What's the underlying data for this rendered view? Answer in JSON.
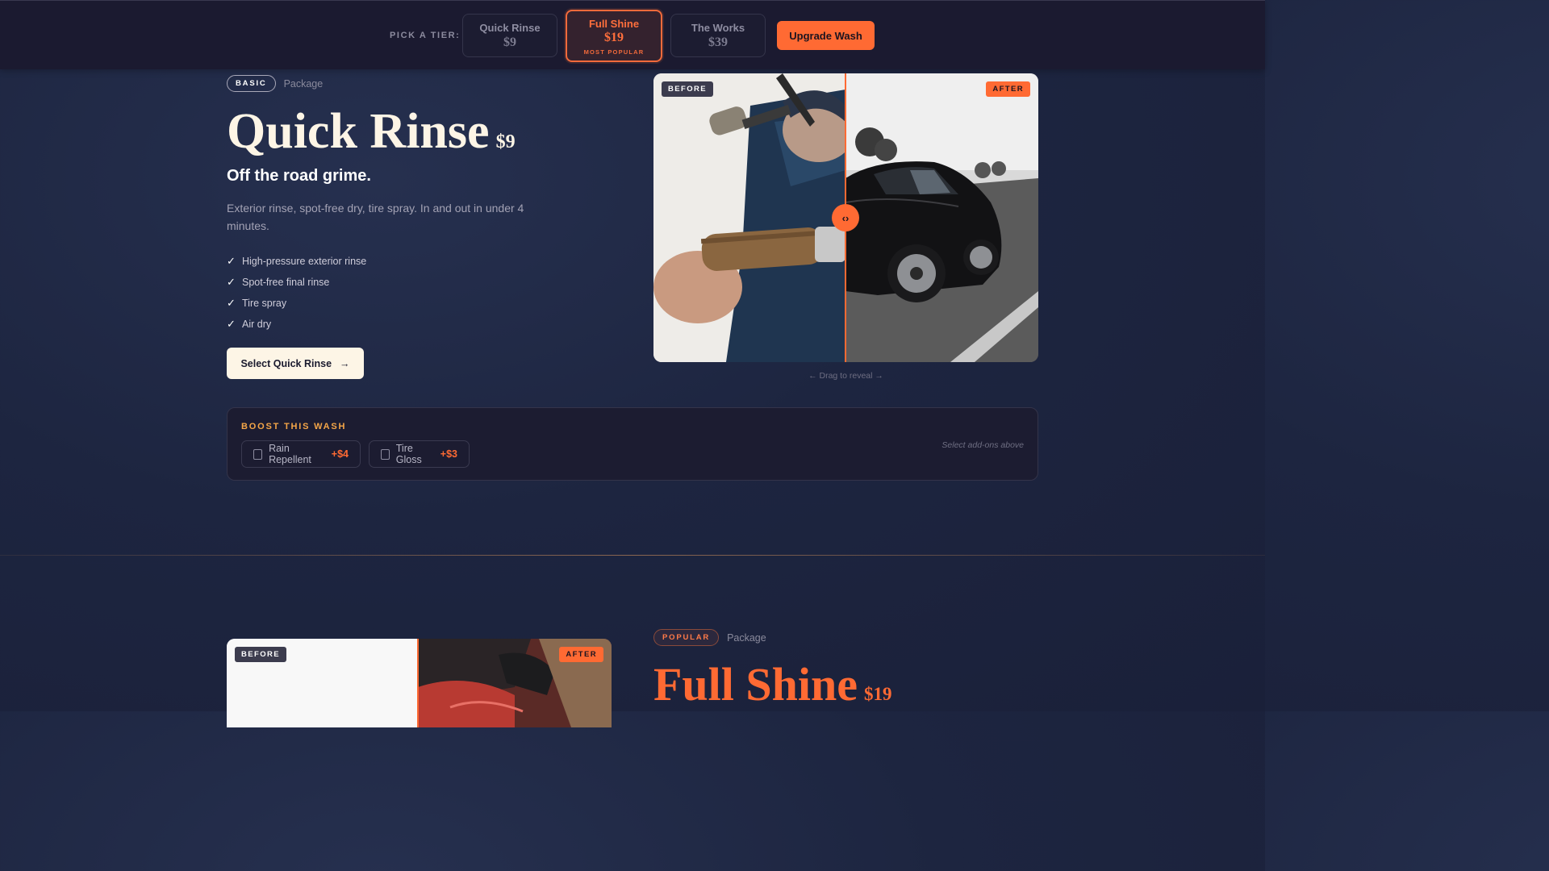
{
  "tier_bar": {
    "label": "PICK A TIER:",
    "tiers": [
      {
        "name": "Quick Rinse",
        "price": "$9"
      },
      {
        "name": "Full Shine",
        "price": "$19",
        "badge": "MOST POPULAR"
      },
      {
        "name": "The Works",
        "price": "$39"
      }
    ],
    "upgrade_label": "Upgrade Wash"
  },
  "hero": {
    "badge": "BASIC",
    "package_word": "Package",
    "title": "Quick Rinse",
    "price": "$9",
    "tagline": "Off the road grime.",
    "description": "Exterior rinse, spot-free dry, tire spray. In and out in under 4 minutes.",
    "features": [
      "High-pressure exterior rinse",
      "Spot-free final rinse",
      "Tire spray",
      "Air dry"
    ],
    "check_glyph": "✓",
    "select_label": "Select Quick Rinse",
    "select_arrow": "→"
  },
  "comparison": {
    "before_label": "BEFORE",
    "after_label": "AFTER",
    "handle_glyph": "‹›",
    "hint": "← Drag to reveal →"
  },
  "boost": {
    "title": "BOOST THIS WASH",
    "addons": [
      {
        "name": "Rain Repellent",
        "price": "+$4"
      },
      {
        "name": "Tire Gloss",
        "price": "+$3"
      }
    ],
    "note": "Select add-ons above"
  },
  "second": {
    "before_label": "BEFORE",
    "after_label": "AFTER",
    "badge": "POPULAR",
    "package_word": "Package",
    "title": "Full Shine",
    "price": "$19"
  },
  "colors": {
    "accent": "#ff6a33",
    "cream": "#fdf5e6",
    "boost_gold": "#f5a648",
    "background": "#1d2540"
  }
}
